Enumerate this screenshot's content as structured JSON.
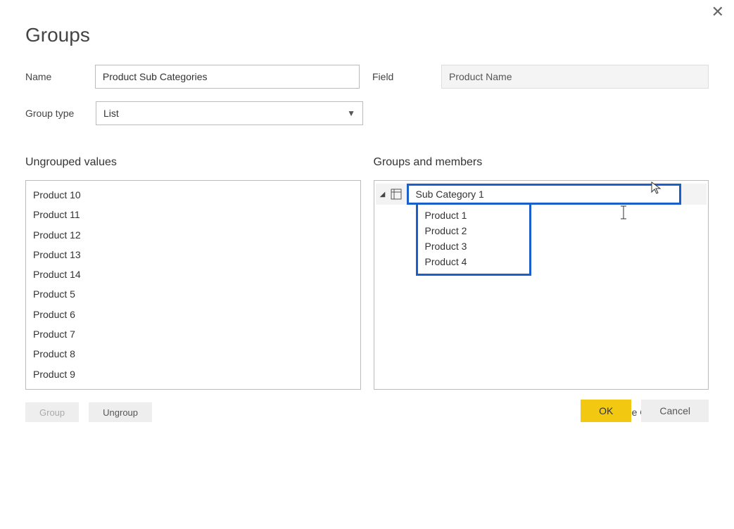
{
  "dialog": {
    "title": "Groups",
    "name_label": "Name",
    "name_value": "Product Sub Categories",
    "field_label": "Field",
    "field_value": "Product Name",
    "group_type_label": "Group type",
    "group_type_value": "List",
    "ungrouped_heading": "Ungrouped values",
    "groups_heading": "Groups and members",
    "group_btn": "Group",
    "ungroup_btn": "Ungroup",
    "include_other_label": "Include Other group",
    "ok": "OK",
    "cancel": "Cancel"
  },
  "ungrouped": [
    "Product 10",
    "Product 11",
    "Product 12",
    "Product 13",
    "Product 14",
    "Product 5",
    "Product 6",
    "Product 7",
    "Product 8",
    "Product 9"
  ],
  "groups": [
    {
      "name": "Sub Category 1",
      "members": [
        "Product 1",
        "Product 2",
        "Product 3",
        "Product 4"
      ]
    }
  ]
}
